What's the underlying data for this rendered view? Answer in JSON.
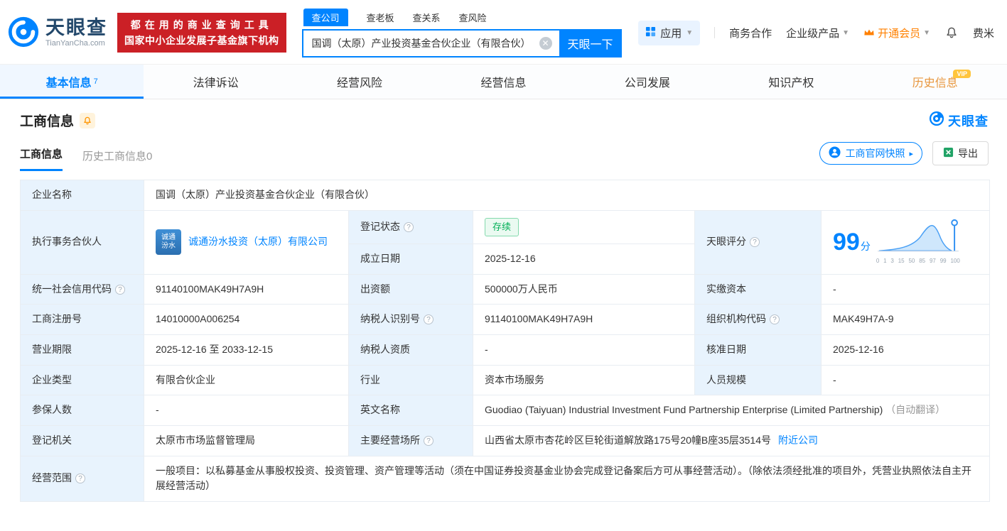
{
  "header": {
    "logo": {
      "name": "天眼查",
      "domain": "TianYanCha.com"
    },
    "banner": {
      "line1": "都在用的商业查询工具",
      "line2": "国家中小企业发展子基金旗下机构"
    },
    "search": {
      "tab_company": "查公司",
      "tab_boss": "查老板",
      "tab_relation": "查关系",
      "tab_risk": "查风险",
      "value": "国调（太原）产业投资基金合伙企业（有限合伙）",
      "button": "天眼一下"
    },
    "menu": {
      "apps": "应用",
      "cooperation": "商务合作",
      "enterprise": "企业级产品",
      "vip": "开通会员",
      "user": "费米"
    }
  },
  "nav": {
    "basic": "基本信息",
    "basic_count": "7",
    "legal": "法律诉讼",
    "risk": "经营风险",
    "business": "经营信息",
    "development": "公司发展",
    "ip": "知识产权",
    "history": "历史信息",
    "history_vip": "VIP"
  },
  "section": {
    "title": "工商信息",
    "brand": "天眼查",
    "subtab_current": "工商信息",
    "subtab_history": "历史工商信息0",
    "snapshot": "工商官网快照",
    "export": "导出"
  },
  "fields": {
    "name_label": "企业名称",
    "name": "国调（太原）产业投资基金合伙企业（有限合伙）",
    "partner_label": "执行事务合伙人",
    "partner_logo_line1": "诚通",
    "partner_logo_line2": "汾水",
    "partner": "诚通汾水投资（太原）有限公司",
    "status_label": "登记状态",
    "status": "存续",
    "established_label": "成立日期",
    "established": "2025-12-16",
    "score_label": "天眼评分",
    "score": "99",
    "score_unit": "分",
    "credit_code_label": "统一社会信用代码",
    "credit_code": "91140100MAK49H7A9H",
    "capital_label": "出资额",
    "capital": "500000万人民币",
    "paid_capital_label": "实缴资本",
    "paid_capital": "-",
    "reg_number_label": "工商注册号",
    "reg_number": "14010000A006254",
    "tax_id_label": "纳税人识别号",
    "tax_id": "91140100MAK49H7A9H",
    "org_code_label": "组织机构代码",
    "org_code": "MAK49H7A-9",
    "term_label": "营业期限",
    "term": "2025-12-16 至 2033-12-15",
    "tax_qualification_label": "纳税人资质",
    "tax_qualification": "-",
    "approval_date_label": "核准日期",
    "approval_date": "2025-12-16",
    "type_label": "企业类型",
    "type": "有限合伙企业",
    "industry_label": "行业",
    "industry": "资本市场服务",
    "staff_label": "人员规模",
    "staff": "-",
    "insured_label": "参保人数",
    "insured": "-",
    "english_name_label": "英文名称",
    "english_name": "Guodiao (Taiyuan) Industrial Investment Fund Partnership Enterprise (Limited Partnership)",
    "english_name_note": "（自动翻译）",
    "authority_label": "登记机关",
    "authority": "太原市市场监督管理局",
    "address_label": "主要经营场所",
    "address": "山西省太原市杏花岭区巨轮街道解放路175号20幢B座35层3514号",
    "address_link": "附近公司",
    "scope_label": "经营范围",
    "scope": "一般项目：以私募基金从事股权投资、投资管理、资产管理等活动（须在中国证券投资基金业协会完成登记备案后方可从事经营活动）。（除依法须经批准的项目外，凭营业执照依法自主开展经营活动）"
  },
  "score_chart": {
    "ticks": [
      "0",
      "1",
      "3",
      "15",
      "50",
      "85",
      "97",
      "99",
      "100"
    ]
  }
}
